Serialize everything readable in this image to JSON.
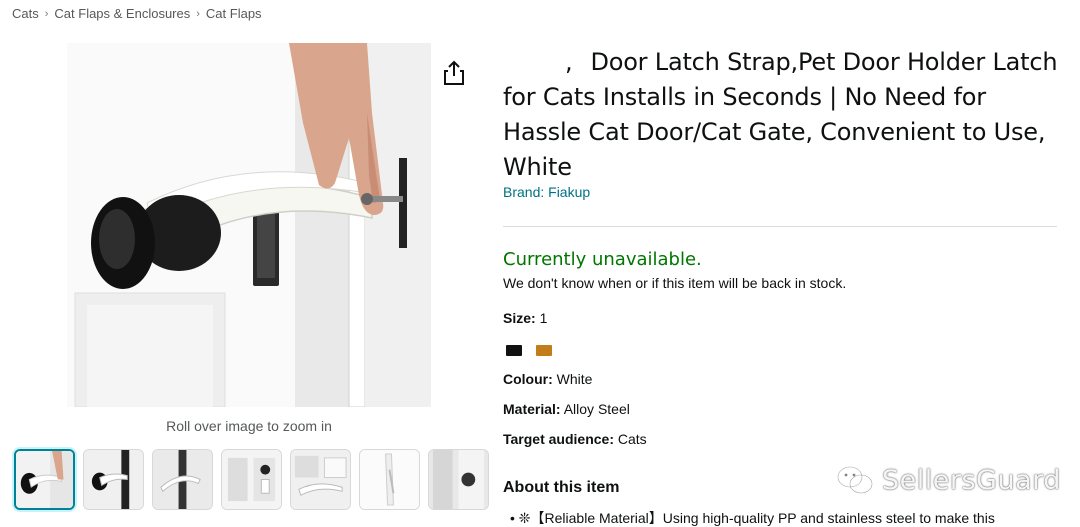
{
  "breadcrumb": {
    "items": [
      "Cats",
      "Cat Flaps & Enclosures",
      "Cat Flaps"
    ],
    "separator": "›"
  },
  "product": {
    "title": "Door Latch Strap,Pet Door Holder Latch for Cats Installs in Seconds | No Need for Hassle Cat Door/Cat Gate, Convenient to Use, White",
    "title_prefix": ",",
    "brand_label": "Brand: Fiakup"
  },
  "gallery": {
    "zoom_hint": "Roll over image to zoom in",
    "thumbnail_count": 7,
    "selected_index": 0
  },
  "availability": {
    "status": "Currently unavailable.",
    "note": "We don't know when or if this item will be back in stock."
  },
  "attributes": {
    "size_label": "Size:",
    "size_value": "1",
    "colour_label": "Colour:",
    "colour_value": "White",
    "material_label": "Material:",
    "material_value": "Alloy Steel",
    "audience_label": "Target audience:",
    "audience_value": "Cats"
  },
  "swatches": [
    {
      "name": "black",
      "color": "#111111"
    },
    {
      "name": "brown",
      "color": "#c27c1c"
    }
  ],
  "about": {
    "heading": "About this item",
    "bullets": [
      "• ❊【Reliable Material】Using high-quality PP and stainless steel to make this"
    ]
  },
  "watermark": {
    "text": "SellersGuard",
    "icon": "wechat-icon"
  },
  "colors": {
    "link": "#007185",
    "in_stock_green": "#007600",
    "selected_thumb": "#008296"
  }
}
